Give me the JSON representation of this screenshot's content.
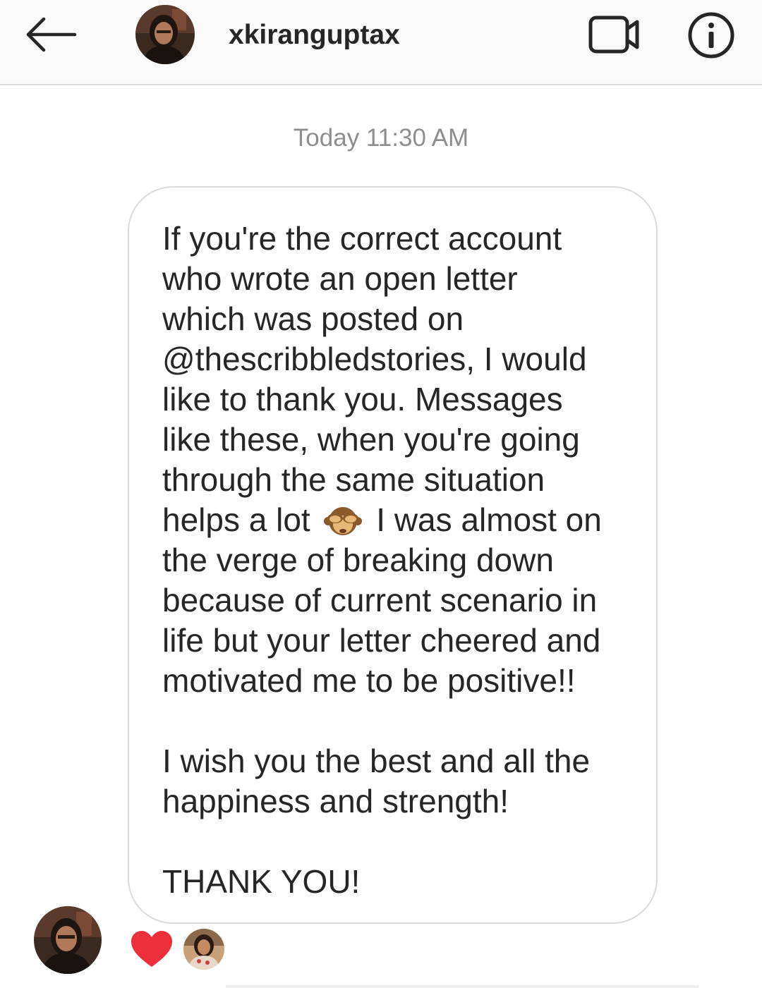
{
  "header": {
    "back_icon": "arrow-left-icon",
    "avatar_icon": "profile-photo-avatar",
    "username": "xkiranguptax",
    "video_icon": "video-camera-icon",
    "info_icon": "info-circle-icon"
  },
  "thread": {
    "timestamp": "Today 11:30 AM",
    "message": {
      "lines": [
        "If you're the correct account",
        "who wrote an open letter",
        "which was posted on",
        "@thescribbledstories, I would",
        "like to thank you. Messages",
        "like these, when you're going",
        "through the same situation",
        "",
        "the verge of breaking down",
        "because of current scenario in",
        "life but your letter cheered and",
        "motivated me to be positive!!",
        "",
        "I wish you the best and all the",
        "happiness and strength!",
        "",
        "THANK YOU!"
      ],
      "line8_before_emoji": "helps a lot",
      "line8_emoji": "see-no-evil-monkey-emoji",
      "line8_after_emoji": "I was almost on"
    },
    "sender_avatar": "profile-photo-avatar",
    "reactions": [
      {
        "icon": "red-heart-icon"
      },
      {
        "icon": "reactor-profile-avatar"
      }
    ]
  },
  "colors": {
    "header_bg": "#fafafa",
    "divider": "#dbdbdb",
    "text": "#262626",
    "muted": "#8e8e8e",
    "heart": "#ed4956"
  }
}
